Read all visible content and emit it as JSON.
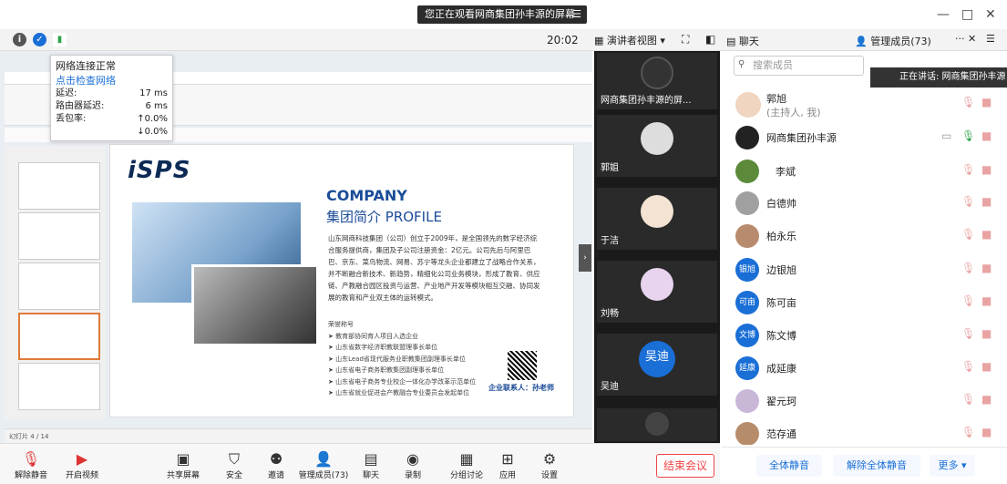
{
  "banner": {
    "text": "您正在观看网商集团孙丰源的屏幕",
    "menu_icon": "menu-icon"
  },
  "window": {
    "minimize": "—",
    "maximize": "□",
    "close": "✕"
  },
  "toolbar": {
    "time": "20:02",
    "speaker_view": "演讲者视图",
    "chat_tab": "聊天",
    "members_tab": "管理成员(73)"
  },
  "network_tip": {
    "status": "网络连接正常",
    "link": "点击检查网络",
    "rows": [
      {
        "label": "延迟:",
        "value": "17 ms"
      },
      {
        "label": "路由器延迟:",
        "value": "6 ms"
      },
      {
        "label": "丢包率:",
        "value": "↑0.0%"
      },
      {
        "label": "",
        "value": "↓0.0%"
      }
    ]
  },
  "slide": {
    "logo": "iSPS",
    "company": "COMPANY",
    "profile": "集团简介 PROFILE",
    "intro": "山东网商科技集团（公司）创立于2009年，是全国领先的数字经济综合服务提供商，集团及子公司注册资金：2亿元。公司先后与阿里巴巴、京东、菜鸟物流、网易、苏宁等龙头企业都建立了战略合作关系，并不断融合新技术、新趋势，精细化公司业务模块，形成了教育、供应链、产教融合园区投资与运营、产业地产开发等模块相互交融、协同发展的教育和产业双主体的运转模式。",
    "honor_title": "荣誉称号",
    "bullets": [
      "教育部协同育人项目入选企业",
      "山东省数字经济职教联盟理事长单位",
      "山东Lead省现代服务业职教集团副理事长单位",
      "山东省电子商务职教集团副理事长单位",
      "山东省电子商务专业校企一体化办学改革示范单位",
      "山东省就业促进会产教融合专业委员会发起单位"
    ],
    "contact": "企业联系人：孙老师",
    "status_bar": "幻灯片 4 / 14"
  },
  "videos": [
    {
      "name": "网商集团孙丰源的屏..."
    },
    {
      "name": "郭姐"
    },
    {
      "name": "于洁"
    },
    {
      "name": "刘畅"
    },
    {
      "name": "吴迪",
      "avatar_text": "吴迪"
    }
  ],
  "members": {
    "search_placeholder": "搜索成员",
    "speaking": "正在讲话: 网商集团孙丰源",
    "list": [
      {
        "name": "郭旭",
        "sub": "(主持人, 我)",
        "avatar": ""
      },
      {
        "name": "网商集团孙丰源",
        "avatar": ""
      },
      {
        "name": "李斌",
        "avatar": ""
      },
      {
        "name": "白德帅",
        "avatar": ""
      },
      {
        "name": "柏永乐",
        "avatar": ""
      },
      {
        "name": "边银旭",
        "avatar": "银旭"
      },
      {
        "name": "陈可亩",
        "avatar": "可亩"
      },
      {
        "name": "陈文博",
        "avatar": "文博"
      },
      {
        "name": "成延康",
        "avatar": "延康"
      },
      {
        "name": "翟元珂",
        "avatar": ""
      },
      {
        "name": "范存通",
        "avatar": ""
      }
    ],
    "footer": {
      "mute_all": "全体静音",
      "unmute_all": "解除全体静音",
      "more": "更多 ▾"
    }
  },
  "bottombar": {
    "unmute": "解除静音",
    "start_video": "开启视频",
    "share_screen": "共享屏幕",
    "security": "安全",
    "invite": "邀请",
    "members": "管理成员(73)",
    "chat": "聊天",
    "record": "录制",
    "breakout": "分组讨论",
    "apps": "应用",
    "settings": "设置",
    "end": "结束会议"
  }
}
